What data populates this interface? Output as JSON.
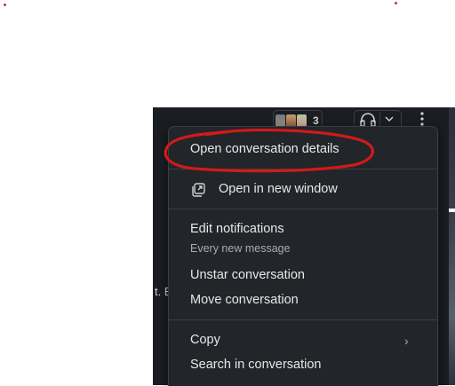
{
  "header": {
    "member_count": "3"
  },
  "background_text": "t. B",
  "menu": {
    "open_details": "Open conversation details",
    "open_new_window": "Open in new window",
    "edit_notifications": "Edit notifications",
    "notifications_setting": "Every new message",
    "unstar": "Unstar conversation",
    "move": "Move conversation",
    "copy": "Copy",
    "copy_arrow": "›",
    "search": "Search in conversation"
  },
  "colors": {
    "annotation": "#d11a1a",
    "menu_bg": "#222529",
    "app_bg": "#1a1d21"
  }
}
